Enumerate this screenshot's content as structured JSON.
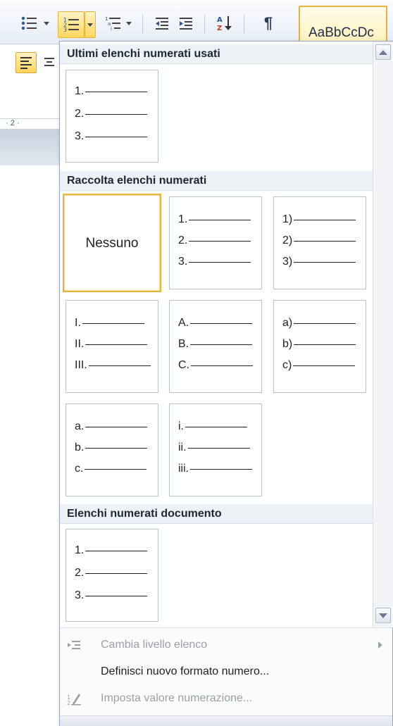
{
  "ribbon": {
    "style_preview": "AaBbCcDc",
    "ruler_text": "· 2 ·",
    "icons": [
      "bullets-icon",
      "numbering-icon",
      "multilevel-list-icon",
      "decrease-indent-icon",
      "increase-indent-icon",
      "sort-icon",
      "pilcrow-icon",
      "align-left-icon"
    ],
    "accent_color": "#e3b53f"
  },
  "panel": {
    "recent_header": "Ultimi elenchi numerati usati",
    "gallery_header": "Raccolta elenchi numerati",
    "document_header": "Elenchi numerati documento",
    "recent_tile": [
      "1.",
      "2.",
      "3."
    ],
    "none_label": "Nessuno",
    "gallery_tiles": [
      [
        "1.",
        "2.",
        "3."
      ],
      [
        "1)",
        "2)",
        "3)"
      ],
      [
        "I.",
        "II.",
        "III."
      ],
      [
        "A.",
        "B.",
        "C."
      ],
      [
        "a)",
        "b)",
        "c)"
      ],
      [
        "a.",
        "b.",
        "c."
      ],
      [
        "i.",
        "ii.",
        "iii."
      ]
    ],
    "document_tile": [
      "1.",
      "2.",
      "3."
    ]
  },
  "menu": {
    "change_level": "Cambia livello elenco",
    "define_format": "Definisci nuovo formato numero...",
    "set_value": "Imposta valore numerazione..."
  }
}
